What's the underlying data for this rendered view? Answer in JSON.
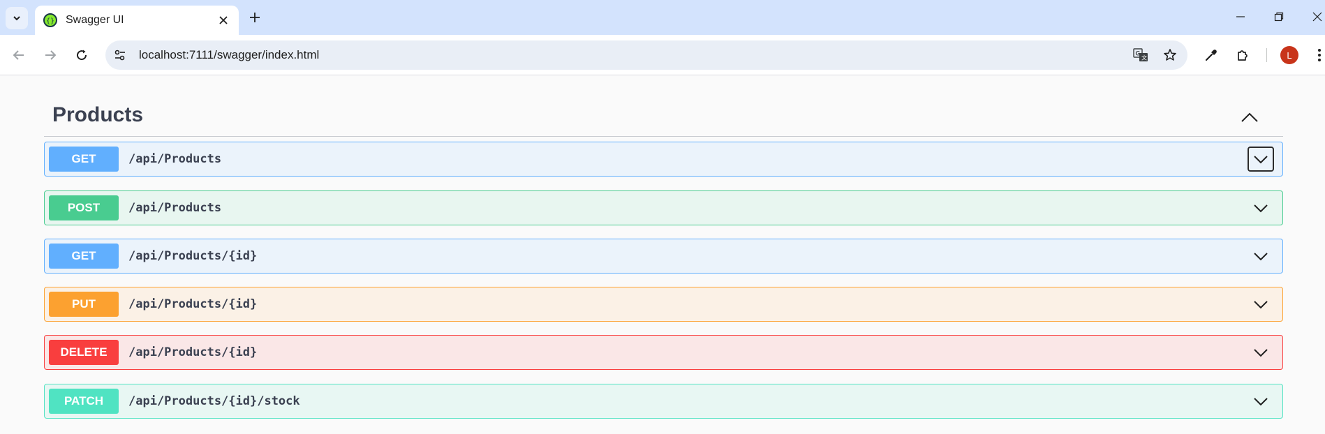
{
  "browser": {
    "tab_title": "Swagger UI",
    "url": "localhost:7111/swagger/index.html",
    "profile_initial": "L"
  },
  "colors": {
    "get": "#61affe",
    "post": "#49cc90",
    "put": "#fca130",
    "delete": "#f93e3e",
    "patch": "#50e3c2"
  },
  "section": {
    "title": "Products"
  },
  "operations": [
    {
      "method": "GET",
      "path": "/api/Products"
    },
    {
      "method": "POST",
      "path": "/api/Products"
    },
    {
      "method": "GET",
      "path": "/api/Products/{id}"
    },
    {
      "method": "PUT",
      "path": "/api/Products/{id}"
    },
    {
      "method": "DELETE",
      "path": "/api/Products/{id}"
    },
    {
      "method": "PATCH",
      "path": "/api/Products/{id}/stock"
    }
  ]
}
